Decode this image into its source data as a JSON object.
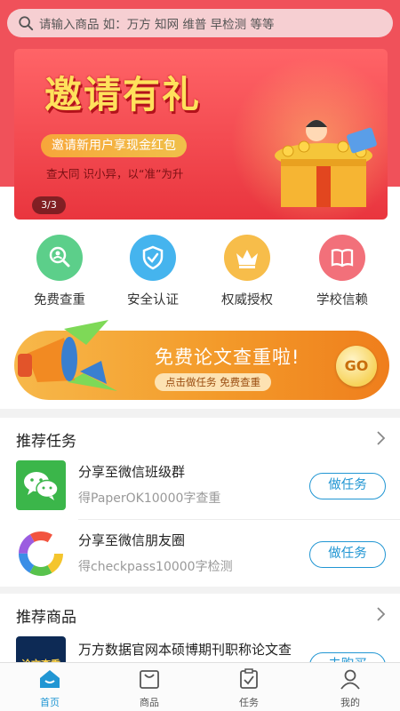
{
  "search": {
    "placeholder": "请输入商品 如：万方 知网 维普 早检测 等等"
  },
  "banner": {
    "title": "邀请有礼",
    "pill": "邀请新用户享现金红包",
    "slogan": "查大同 识小异，以“准”为升",
    "counter": "3/3"
  },
  "quick": [
    {
      "label": "免费查重",
      "color": "#5ccf8a",
      "icon": "search-person-icon"
    },
    {
      "label": "安全认证",
      "color": "#45b4ee",
      "icon": "shield-check-icon"
    },
    {
      "label": "权威授权",
      "color": "#f7bd4a",
      "icon": "crown-icon"
    },
    {
      "label": "学校信赖",
      "color": "#f2707a",
      "icon": "book-icon"
    }
  ],
  "promo": {
    "headline": "免费论文查重啦!",
    "sub": "点击做任务 免费查重",
    "go": "GO"
  },
  "tasks_section": {
    "title": "推荐任务"
  },
  "tasks": [
    {
      "name": "分享至微信班级群",
      "desc": "得PaperOK10000字查重",
      "button": "做任务",
      "icon": "wechat-icon"
    },
    {
      "name": "分享至微信朋友圈",
      "desc": "得checkpass10000字检测",
      "button": "做任务",
      "icon": "moments-icon"
    }
  ],
  "goods_section": {
    "title": "推荐商品"
  },
  "goods": [
    {
      "name": "万方数据官网本硕博期刊职称论文查",
      "button": "去购买",
      "thumb_text": "论文查重"
    }
  ],
  "tabbar": [
    {
      "label": "首页",
      "active": true,
      "icon": "home-icon"
    },
    {
      "label": "商品",
      "active": false,
      "icon": "bag-icon"
    },
    {
      "label": "任务",
      "active": false,
      "icon": "clipboard-icon"
    },
    {
      "label": "我的",
      "active": false,
      "icon": "user-icon"
    }
  ],
  "colors": {
    "brand_red": "#f0515a",
    "accent_blue": "#2196d3",
    "promo_orange": "#f39a2a"
  }
}
